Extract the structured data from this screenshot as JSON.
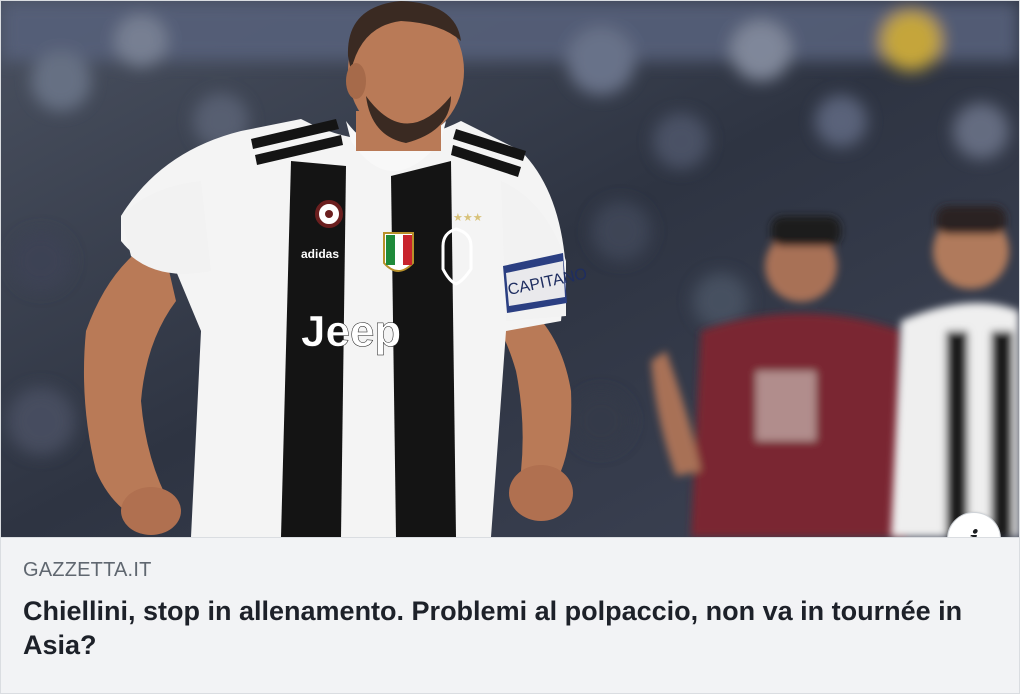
{
  "card": {
    "source": "GAZZETTA.IT",
    "headline": "Chiellini, stop in allenamento. Problemi al polpaccio, non va in tournée in Asia?",
    "info_icon": "i"
  },
  "photo": {
    "sponsor": "Jeep",
    "kit_brand": "adidas",
    "armband": "CAPITANO",
    "colors": {
      "jersey_black": "#141414",
      "jersey_white": "#f4f4f4",
      "skin": "#b97a57",
      "opponent_maroon": "#7a2630",
      "crowd": "#3a4252"
    }
  }
}
